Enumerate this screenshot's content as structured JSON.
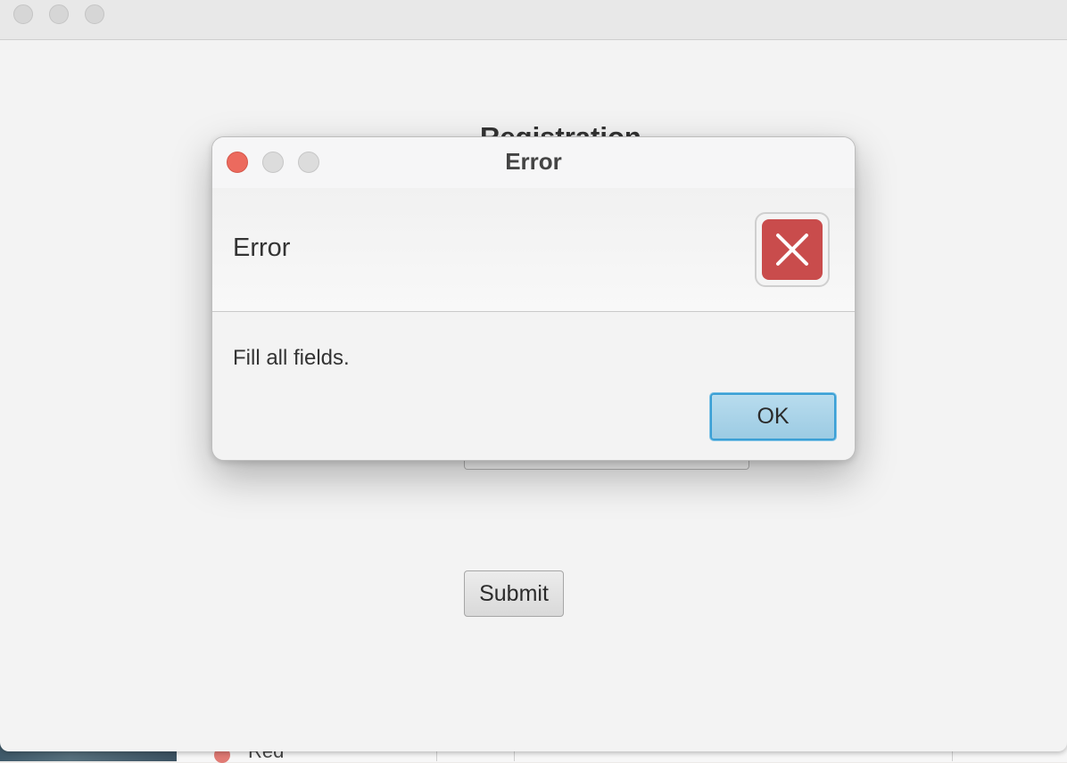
{
  "main_window": {
    "heading": "Registration",
    "submit_label": "Submit"
  },
  "behind_window": {
    "partial_label": "Red"
  },
  "dialog": {
    "title": "Error",
    "header_text": "Error",
    "content_text": "Fill all fields.",
    "ok_label": "OK",
    "icon": "error-x-icon"
  },
  "colors": {
    "error_red": "#c94c4c",
    "close_button": "#ec6a5e",
    "default_button_border": "#3a9fd5"
  }
}
